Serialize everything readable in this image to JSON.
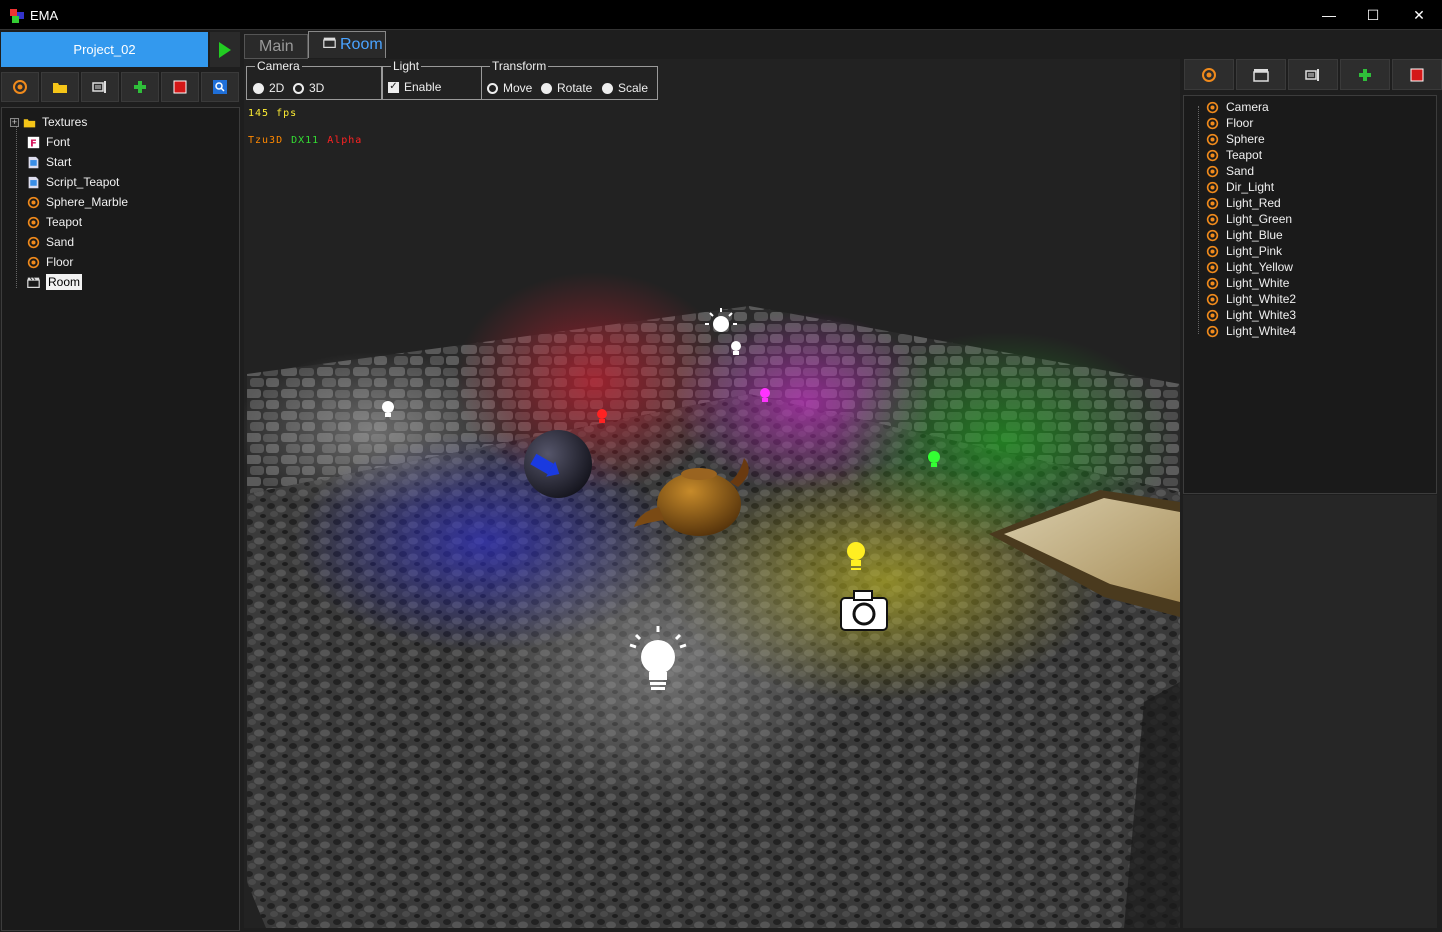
{
  "window": {
    "title": "EMA",
    "minimize_glyph": "—",
    "maximize_glyph": "☐",
    "close_glyph": "✕"
  },
  "left": {
    "project_label": "Project_02",
    "toolbar_icons": [
      "object-icon",
      "folder-icon",
      "script-icon",
      "add-icon",
      "delete-icon",
      "search-icon"
    ],
    "tree": {
      "root": {
        "label": "Textures",
        "icon": "folder-icon",
        "expander": "+"
      },
      "items": [
        {
          "label": "Font",
          "icon": "font-icon"
        },
        {
          "label": "Start",
          "icon": "script-file-icon"
        },
        {
          "label": "Script_Teapot",
          "icon": "script-file-icon"
        },
        {
          "label": "Sphere_Marble",
          "icon": "object-icon"
        },
        {
          "label": "Teapot",
          "icon": "object-icon"
        },
        {
          "label": "Sand",
          "icon": "object-icon"
        },
        {
          "label": "Floor",
          "icon": "object-icon"
        },
        {
          "label": "Room",
          "icon": "scene-icon",
          "selected": true
        }
      ]
    }
  },
  "tabs": [
    {
      "label": "Main",
      "active": false
    },
    {
      "label": "Room",
      "active": true,
      "icon": "scene-icon"
    }
  ],
  "options": {
    "camera": {
      "legend": "Camera",
      "opt_2d": "2D",
      "opt_3d": "3D",
      "selected": "2D"
    },
    "light": {
      "legend": "Light",
      "enable_label": "Enable",
      "enabled": true
    },
    "transform": {
      "legend": "Transform",
      "move": "Move",
      "rotate": "Rotate",
      "scale": "Scale",
      "selected": "Rotate"
    }
  },
  "viewport": {
    "fps_text": "145 fps",
    "engine_name": "Tzu3D",
    "api": "DX11",
    "stage": "Alpha",
    "colors": {
      "fps": "#ffee33",
      "engine": "#ff8800",
      "api": "#33dd33",
      "stage": "#ff2222"
    }
  },
  "right": {
    "toolbar_icons": [
      "object-icon",
      "scene-icon",
      "script-icon",
      "add-icon",
      "delete-icon"
    ],
    "objects": [
      "Camera",
      "Floor",
      "Sphere",
      "Teapot",
      "Sand",
      "Dir_Light",
      "Light_Red",
      "Light_Green",
      "Light_Blue",
      "Light_Pink",
      "Light_Yellow",
      "Light_White",
      "Light_White2",
      "Light_White3",
      "Light_White4"
    ]
  },
  "colors": {
    "accent": "#3399ee",
    "tab_active": "#4aa3ff",
    "play": "#22cc22"
  }
}
